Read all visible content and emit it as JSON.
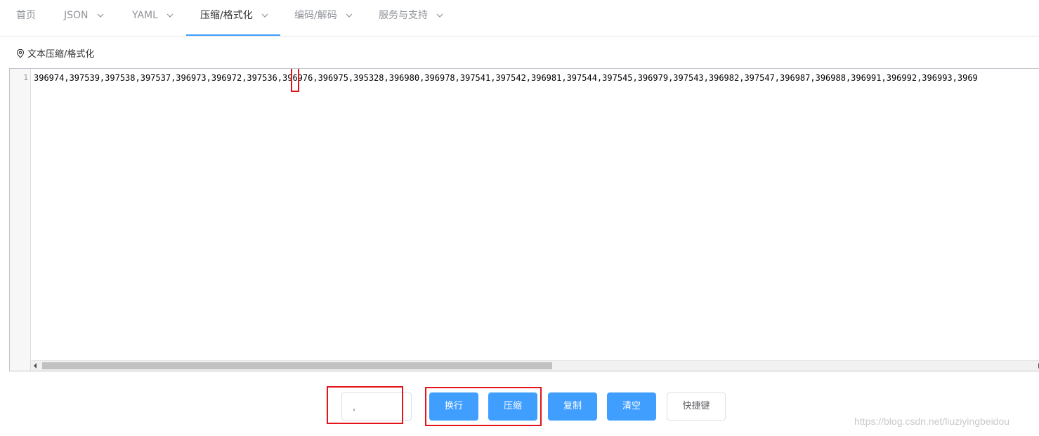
{
  "nav": {
    "items": [
      {
        "label": "首页",
        "has_dropdown": false,
        "active": false
      },
      {
        "label": "JSON",
        "has_dropdown": true,
        "active": false
      },
      {
        "label": "YAML",
        "has_dropdown": true,
        "active": false
      },
      {
        "label": "压缩/格式化",
        "has_dropdown": true,
        "active": true
      },
      {
        "label": "编码/解码",
        "has_dropdown": true,
        "active": false
      },
      {
        "label": "服务与支持",
        "has_dropdown": true,
        "active": false
      }
    ]
  },
  "breadcrumb": {
    "icon": "location-icon",
    "label": "文本压缩/格式化"
  },
  "editor": {
    "line_number": "1",
    "content": "396974,397539,397538,397537,396973,396972,397536,396976,396975,395328,396980,396978,397541,397542,396981,397544,397545,396979,397543,396982,397547,396987,396988,396991,396992,396993,3969"
  },
  "controls": {
    "separator_value": ",",
    "buttons": {
      "wrap": "换行",
      "compress": "压缩",
      "copy": "复制",
      "clear": "清空",
      "shortcuts": "快捷键"
    }
  },
  "watermark": "https://blog.csdn.net/liuziyingbeidou",
  "colors": {
    "primary": "#409eff",
    "highlight": "#e4141b"
  }
}
